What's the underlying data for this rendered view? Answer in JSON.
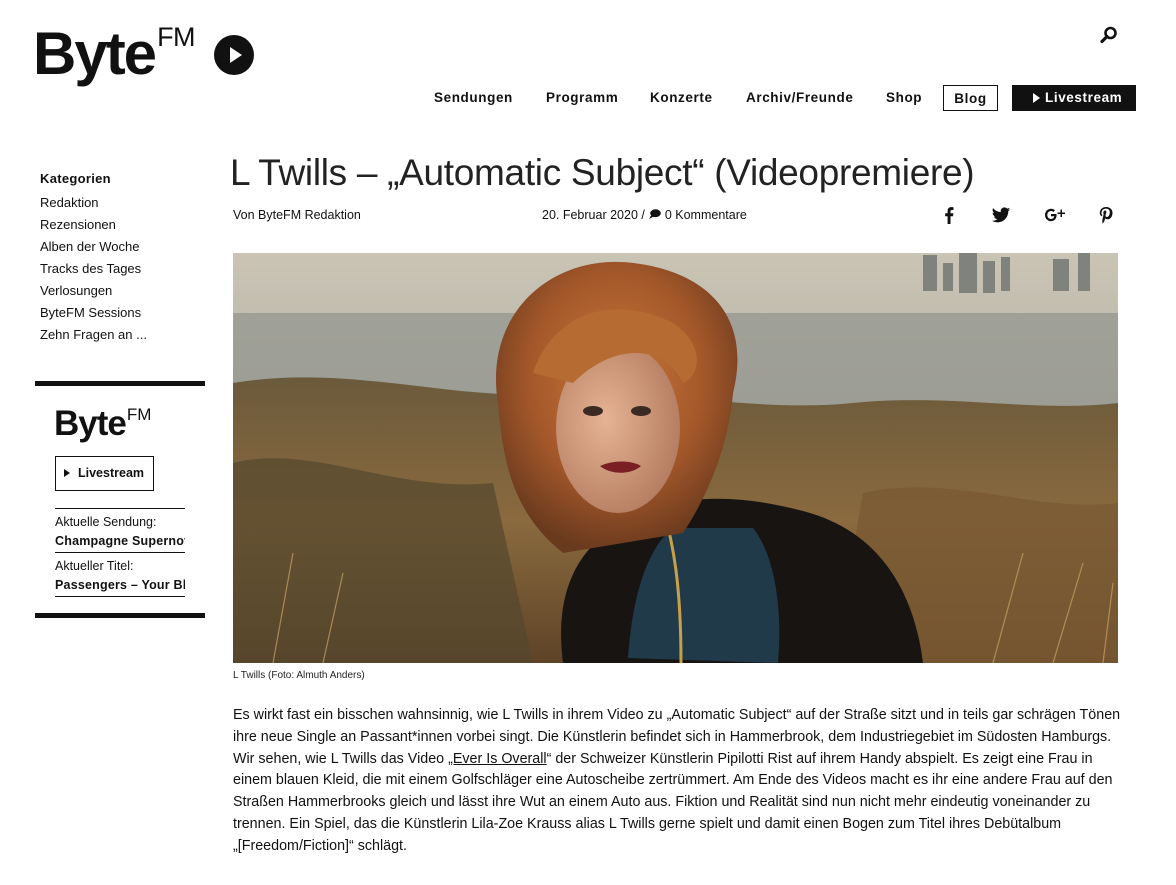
{
  "header": {
    "logo_text": "Byte",
    "logo_sup": "FM",
    "nav": [
      {
        "label": "Sendungen"
      },
      {
        "label": "Programm"
      },
      {
        "label": "Konzerte"
      },
      {
        "label": "Archiv/Freunde"
      },
      {
        "label": "Shop"
      },
      {
        "label": "Blog"
      },
      {
        "label": "Livestream"
      }
    ]
  },
  "sidebar": {
    "heading": "Kategorien",
    "categories": [
      "Redaktion",
      "Rezensionen",
      "Alben der Woche",
      "Tracks des Tages",
      "Verlosungen",
      "ByteFM Sessions",
      "Zehn Fragen an ..."
    ],
    "widget": {
      "logo_text": "Byte",
      "logo_sup": "FM",
      "livestream_label": "Livestream",
      "current_show_label": "Aktuelle Sendung:",
      "current_show": "Champagne Supernova",
      "current_track_label": "Aktueller Titel:",
      "current_track": "Passengers – Your Blues"
    }
  },
  "article": {
    "title": "L Twills – „Automatic Subject“ (Videopremiere)",
    "author_prefix": "Von",
    "author": "ByteFM Redaktion",
    "date": "20. Februar 2020",
    "separator": "/",
    "comments": "0 Kommentare",
    "caption": "L Twills (Foto: Almuth Anders)",
    "body_part1": "Es wirkt fast ein bisschen wahnsinnig, wie L Twills in ihrem Video zu „Automatic Subject“ auf der Straße sitzt und in teils gar schrägen Tönen ihre neue Single an Passant*innen vorbei singt. Die Künstlerin befindet sich in Hammerbrook, dem Industriegebiet im Südosten Hamburgs. Wir sehen, wie L Twills das Video ",
    "body_link": "„Ever Is Overall",
    "body_part2": "“ der Schweizer Künstlerin Pipilotti Rist auf ihrem Handy abspielt. Es zeigt eine Frau in einem blauen Kleid, die mit einem Golfschläger eine Autoscheibe zertrümmert. Am Ende des Videos macht es ihr eine andere Frau auf den Straßen Hammerbrooks gleich und lässt ihre Wut an einem Auto aus. Fiktion und Realität sind nun nicht mehr eindeutig voneinander zu trennen. Ein Spiel, das die Künstlerin Lila-Zoe Krauss alias L Twills gerne spielt und damit einen Bogen zum Titel ihres Debütalbum „[Freedom/Fiction]“ schlägt."
  },
  "share": [
    {
      "icon": "facebook-icon",
      "glyph": "f"
    },
    {
      "icon": "twitter-icon",
      "glyph": ""
    },
    {
      "icon": "google-plus-icon",
      "glyph": "g+"
    },
    {
      "icon": "pinterest-icon",
      "glyph": "p"
    }
  ]
}
